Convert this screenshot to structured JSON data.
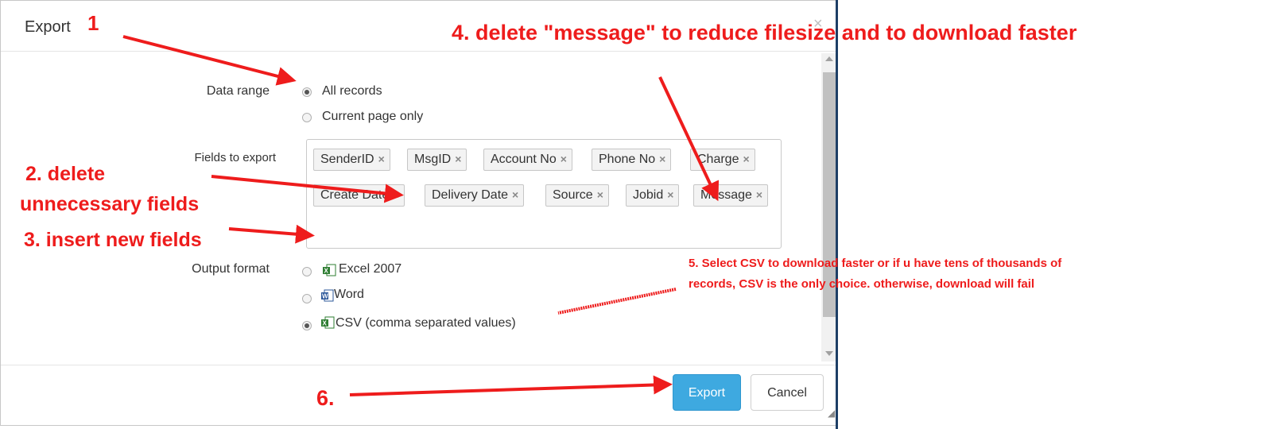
{
  "dialog": {
    "title": "Export",
    "close": "×"
  },
  "form": {
    "data_range_label": "Data range",
    "data_range_options": [
      "All records",
      "Current page only"
    ],
    "data_range_selected": "All records",
    "fields_label": "Fields to export",
    "fields": [
      "SenderID",
      "MsgID",
      "Account No",
      "Phone No",
      "Charge",
      "Create Date",
      "Delivery Date",
      "Source",
      "Jobid",
      "Message"
    ],
    "tag_remove": "×",
    "output_label": "Output format",
    "output_options": [
      "Excel 2007",
      "Word",
      "CSV (comma separated values)"
    ],
    "output_selected": "CSV (comma separated values)"
  },
  "footer": {
    "export_label": "Export",
    "cancel_label": "Cancel"
  },
  "annotations": {
    "a1": "1",
    "a2_line1": "2. delete",
    "a2_line2": "unnecessary fields",
    "a3": "3. insert new fields",
    "a4": "4. delete \"message\" to reduce filesize and to download faster",
    "a5_line1": "5. Select CSV to download faster or if u have tens of thousands of",
    "a5_line2": "records, CSV is the only choice. otherwise, download will fail",
    "a6": "6."
  },
  "colors": {
    "annotation": "#ee1c1c",
    "primary_button": "#3ea9e0"
  },
  "icons": {
    "excel": "excel-file-icon",
    "word": "word-file-icon",
    "csv": "csv-file-icon"
  }
}
